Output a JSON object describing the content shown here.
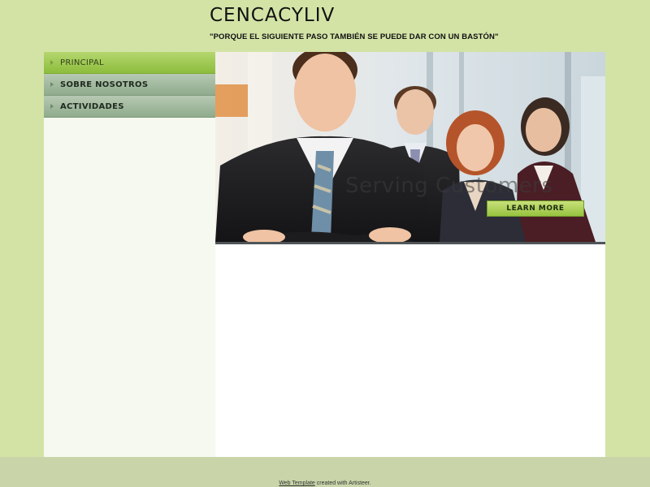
{
  "header": {
    "title": "CENCACYLIV",
    "slogan": "\"PORQUE EL SIGUIENTE PASO TAMBIÉN SE PUEDE DAR CON UN BASTÓN\""
  },
  "menu": {
    "items": [
      {
        "label": "PRINCIPAL",
        "active": true
      },
      {
        "label": "SOBRE NOSOTROS",
        "active": false
      },
      {
        "label": "ACTIVIDADES",
        "active": false
      }
    ]
  },
  "banner": {
    "caption": "Serving Customers",
    "button_label": "LEARN MORE"
  },
  "footer": {
    "link_label": "Web Template",
    "text": "created with Artisteer."
  },
  "colors": {
    "page_bg": "#d3e3a6",
    "accent": "#8cbd3c",
    "sidebar_bg": "#f6f9ef"
  }
}
